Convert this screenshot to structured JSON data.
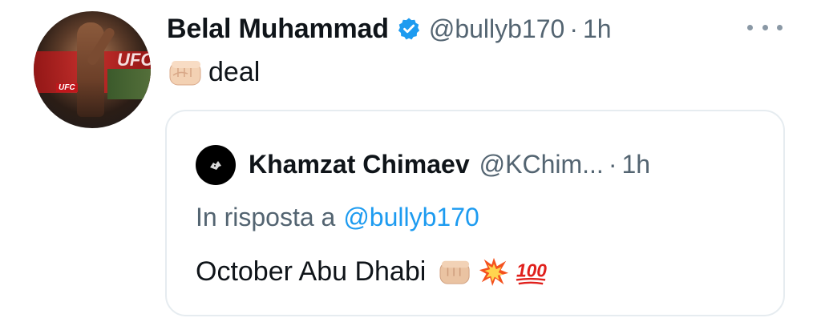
{
  "author": {
    "name": "Belal Muhammad",
    "handle": "@bullyb170",
    "separator": "·",
    "time": "1h",
    "verified": true,
    "avatar_logo": "UFC"
  },
  "tweet": {
    "text": "deal",
    "emoji": "oncoming-fist"
  },
  "quoted": {
    "name": "Khamzat Chimaev",
    "handle": "@KChim...",
    "separator": "·",
    "time": "1h",
    "reply_prefix": "In risposta a",
    "reply_to": "@bullyb170",
    "text": "October Abu Dhabi",
    "emojis": [
      "oncoming-fist",
      "collision",
      "hundred-points"
    ]
  },
  "colors": {
    "text": "#0f1419",
    "secondary": "#536471",
    "link": "#1d9bf0",
    "border": "#e6ecf0",
    "verified": "#1d9bf0"
  }
}
